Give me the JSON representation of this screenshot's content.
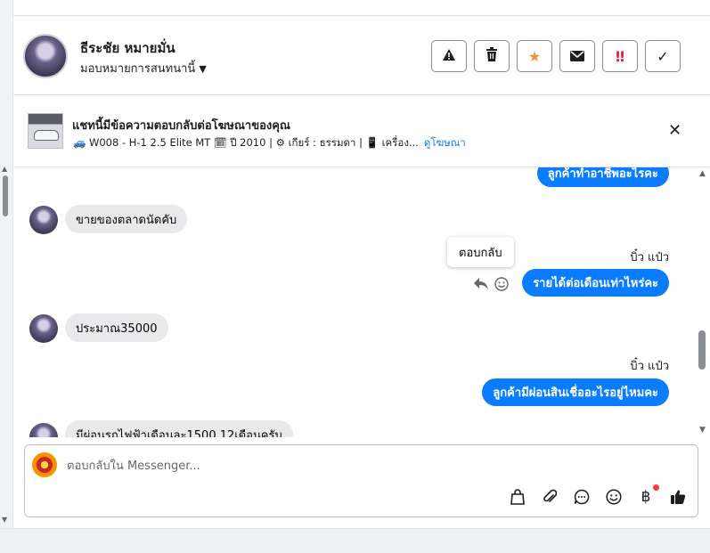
{
  "header": {
    "name": "ธีระชัย หมายมั่น",
    "assign_label": "มอบหมายการสนทนานี้",
    "actions": [
      {
        "icon": "warning-icon",
        "glyph": "⚠"
      },
      {
        "icon": "trash-icon",
        "glyph": "🗑"
      },
      {
        "icon": "star-icon",
        "glyph": "★",
        "color": "#f7923b"
      },
      {
        "icon": "mail-icon",
        "glyph": "✉"
      },
      {
        "icon": "priority-icon",
        "glyph": "‼",
        "color": "#e41e3f"
      },
      {
        "icon": "check-icon",
        "glyph": "✓"
      }
    ]
  },
  "ad": {
    "title": "แชทนี้มีข้อความตอบกลับต่อโฆษณาของคุณ",
    "details": "🚙 W008 - H-1 2.5 Elite MT 🗓 ปี 2010 | ⚙ เกียร์ : ธรรมดา | 📱 เครื่อง...",
    "link": "ดูโฆษณา",
    "close": "✕"
  },
  "messages": {
    "m1": "ลูกค้าทำอาชีพอะไรคะ",
    "m2": "ขายของตลาดนัดคับ",
    "sender1": "บิ๋ว แป๋ว",
    "tooltip": "ตอบกลับ",
    "m3": "รายได้ต่อเดือนเท่าไหร่คะ",
    "m4": "ประมาณ35000",
    "sender2": "บิ๋ว แป๋ว",
    "m5": "ลูกค้ามีผ่อนสินเชื่ออะไรอยู่ไหมคะ",
    "m6": "มีผ่อนรถไฟฟ้าเดือนละ1500 12เดือนครับ"
  },
  "composer": {
    "placeholder": "ตอบกลับใน Messenger..."
  },
  "colors": {
    "accent": "#0a7cff",
    "link": "#1877f2",
    "incoming": "#e9e9eb"
  }
}
